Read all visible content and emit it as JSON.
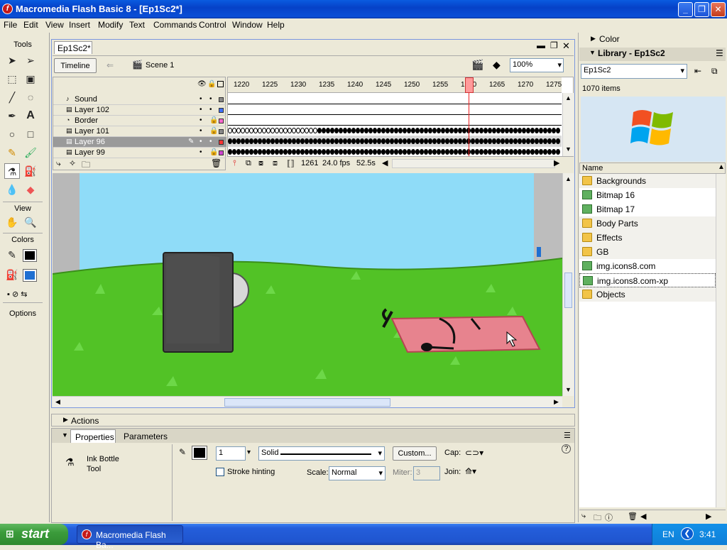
{
  "window": {
    "title": "Macromedia Flash Basic 8 - [Ep1Sc2*]",
    "app_icon": "flash-icon"
  },
  "menu": [
    "File",
    "Edit",
    "View",
    "Insert",
    "Modify",
    "Text",
    "Commands",
    "Control",
    "Window",
    "Help"
  ],
  "tools": {
    "title": "Tools",
    "view_label": "View",
    "colors_label": "Colors",
    "options_label": "Options",
    "stroke_color": "#000000",
    "fill_color": "#1f6fd1"
  },
  "document": {
    "tab": "Ep1Sc2*",
    "timeline_button": "Timeline",
    "scene": "Scene 1",
    "zoom": "100%"
  },
  "timeline": {
    "layers": [
      {
        "name": "Sound",
        "icon": "sound-layer-icon",
        "locked": false,
        "color": "#888888"
      },
      {
        "name": "Layer 102",
        "icon": "layer-icon",
        "locked": false,
        "color": "#3f6fff"
      },
      {
        "name": "Border",
        "icon": "mask-layer-icon",
        "locked": true,
        "color": "#ff66cc"
      },
      {
        "name": "Layer 101",
        "icon": "layer-icon",
        "locked": true,
        "color": "#888888"
      },
      {
        "name": "Layer 96",
        "icon": "layer-icon",
        "locked": false,
        "color": "#ff3333",
        "selected": true
      },
      {
        "name": "Layer 99",
        "icon": "layer-icon",
        "locked": true,
        "color": "#cc44cc"
      }
    ],
    "frame_numbers": [
      "1220",
      "1225",
      "1230",
      "1235",
      "1240",
      "1245",
      "1250",
      "1255",
      "1260",
      "1265",
      "1270",
      "1275"
    ],
    "current_frame": "1261",
    "fps": "24.0 fps",
    "elapsed": "52.5s"
  },
  "panels": {
    "actions": "Actions",
    "properties_tab": "Properties",
    "parameters_tab": "Parameters"
  },
  "properties": {
    "tool_name_line1": "Ink Bottle",
    "tool_name_line2": "Tool",
    "stroke_width": "1",
    "stroke_style": "Solid",
    "custom_button": "Custom...",
    "cap_label": "Cap:",
    "join_label": "Join:",
    "stroke_hinting_label": "Stroke hinting",
    "scale_label": "Scale:",
    "scale_value": "Normal",
    "miter_label": "Miter:",
    "miter_value": "3"
  },
  "right_panel": {
    "color_title": "Color",
    "library_title": "Library - Ep1Sc2",
    "library_select": "Ep1Sc2",
    "item_count": "1070 items",
    "name_column": "Name",
    "items": [
      {
        "name": "Backgrounds",
        "type": "folder"
      },
      {
        "name": "Bitmap 16",
        "type": "bitmap"
      },
      {
        "name": "Bitmap 17",
        "type": "bitmap"
      },
      {
        "name": "Body Parts",
        "type": "folder"
      },
      {
        "name": "Effects",
        "type": "folder"
      },
      {
        "name": "GB",
        "type": "folder"
      },
      {
        "name": "img.icons8.com",
        "type": "bitmap"
      },
      {
        "name": "img.icons8.com-xp",
        "type": "bitmap",
        "selected": true
      },
      {
        "name": "Objects",
        "type": "folder"
      }
    ]
  },
  "taskbar": {
    "start": "start",
    "task": "Macromedia Flash Ba...",
    "lang": "EN",
    "clock": "3:41"
  }
}
